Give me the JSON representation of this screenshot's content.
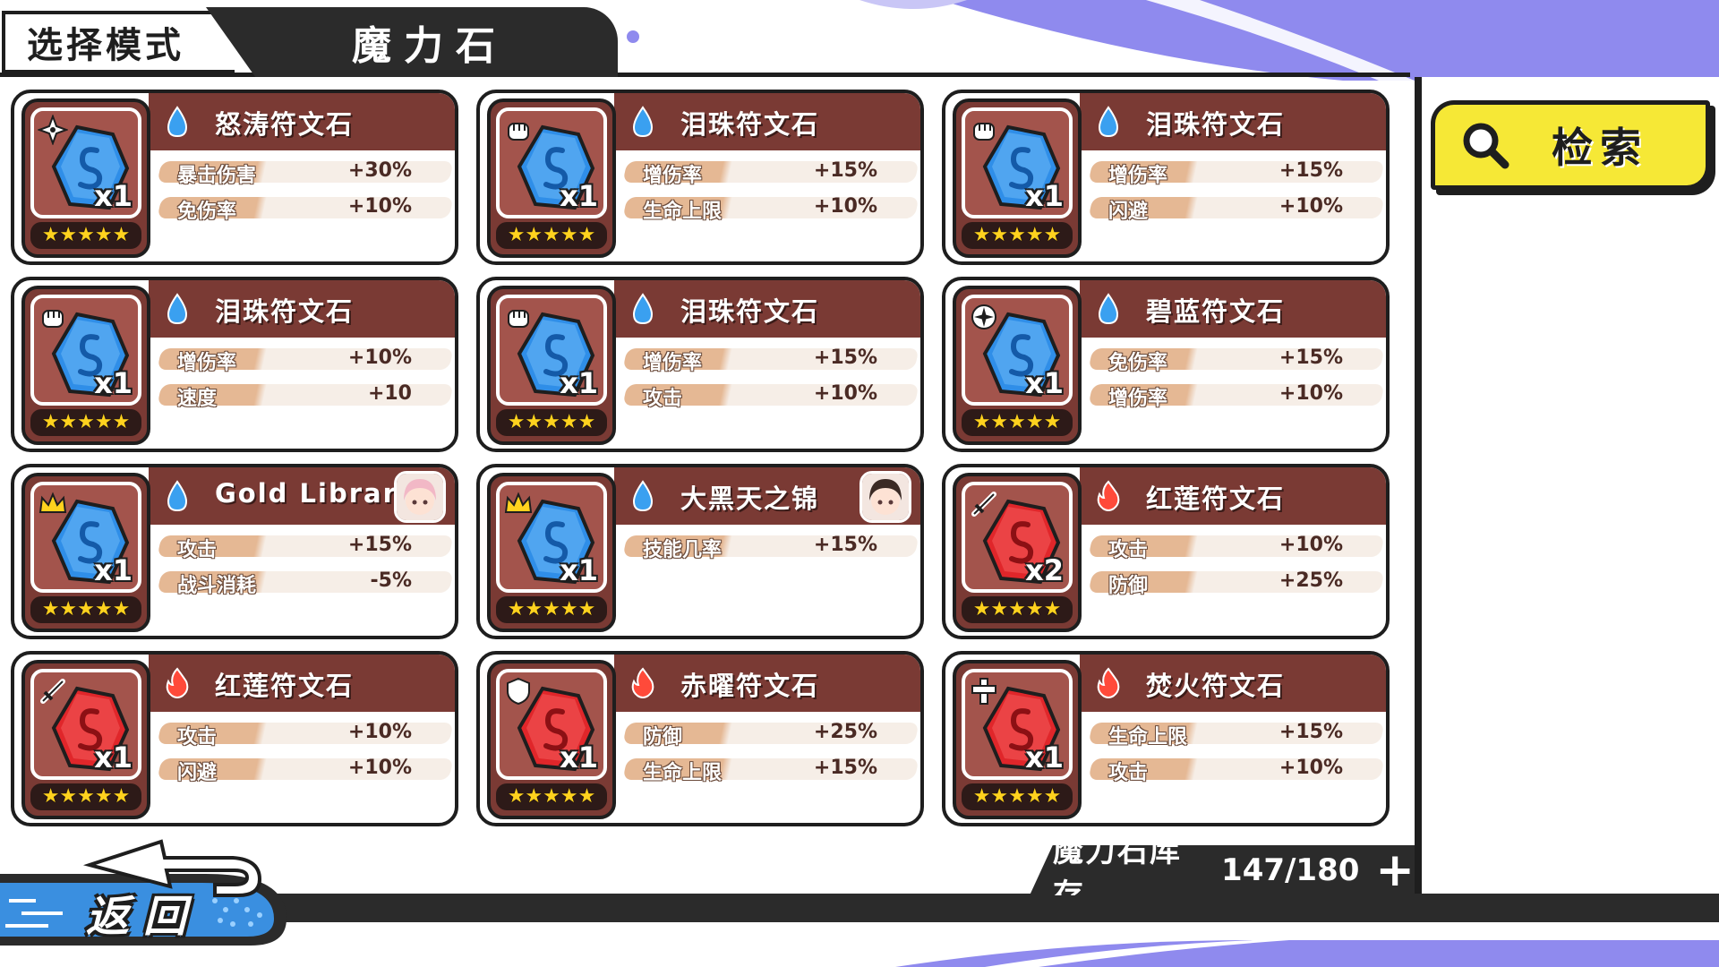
{
  "header": {
    "mode_label": "选择模式",
    "title": "魔力石"
  },
  "search": {
    "label": "检索",
    "icon": "magnifier-icon"
  },
  "colors": {
    "card_header": "#7a3a34",
    "accent_yellow": "#f6e836",
    "dark": "#2b2b2b",
    "water_gem": "#2f8ee8",
    "fire_gem": "#e0262a",
    "bg_purple": "#8f8aee"
  },
  "cards": [
    {
      "name": "怒涛符文石",
      "element": "water",
      "type_icon": "shuriken-icon",
      "qty": "x1",
      "stars": "★★★★★",
      "stats": [
        {
          "label": "暴击伤害",
          "value": "+30%"
        },
        {
          "label": "免伤率",
          "value": "+10%"
        }
      ]
    },
    {
      "name": "泪珠符文石",
      "element": "water",
      "type_icon": "fist-icon",
      "qty": "x1",
      "stars": "★★★★★",
      "stats": [
        {
          "label": "增伤率",
          "value": "+15%"
        },
        {
          "label": "生命上限",
          "value": "+10%"
        }
      ]
    },
    {
      "name": "泪珠符文石",
      "element": "water",
      "type_icon": "fist-icon",
      "qty": "x1",
      "stars": "★★★★★",
      "stats": [
        {
          "label": "增伤率",
          "value": "+15%"
        },
        {
          "label": "闪避",
          "value": "+10%"
        }
      ]
    },
    {
      "name": "泪珠符文石",
      "element": "water",
      "type_icon": "fist-icon",
      "qty": "x1",
      "stars": "★★★★★",
      "stats": [
        {
          "label": "增伤率",
          "value": "+10%"
        },
        {
          "label": "速度",
          "value": "+10"
        }
      ]
    },
    {
      "name": "泪珠符文石",
      "element": "water",
      "type_icon": "fist-icon",
      "qty": "x1",
      "stars": "★★★★★",
      "stats": [
        {
          "label": "增伤率",
          "value": "+15%"
        },
        {
          "label": "攻击",
          "value": "+10%"
        }
      ]
    },
    {
      "name": "碧蓝符文石",
      "element": "water",
      "type_icon": "compass-icon",
      "qty": "x1",
      "stars": "★★★★★",
      "stats": [
        {
          "label": "免伤率",
          "value": "+15%"
        },
        {
          "label": "增伤率",
          "value": "+10%"
        }
      ]
    },
    {
      "name": "Gold Library",
      "element": "water",
      "type_icon": "crown-icon",
      "qty": "x1",
      "stars": "★★★★★",
      "portrait": "pink-hair-character-portrait",
      "stats": [
        {
          "label": "攻击",
          "value": "+15%"
        },
        {
          "label": "战斗消耗",
          "value": "-5%"
        }
      ]
    },
    {
      "name": "大黑天之锦",
      "element": "water",
      "type_icon": "crown-icon",
      "qty": "x1",
      "stars": "★★★★★",
      "portrait": "dark-hair-character-portrait",
      "stats": [
        {
          "label": "技能几率",
          "value": "+15%"
        }
      ]
    },
    {
      "name": "红莲符文石",
      "element": "fire",
      "type_icon": "sword-icon",
      "qty": "x2",
      "stars": "★★★★★",
      "stats": [
        {
          "label": "攻击",
          "value": "+10%"
        },
        {
          "label": "防御",
          "value": "+25%"
        }
      ]
    },
    {
      "name": "红莲符文石",
      "element": "fire",
      "type_icon": "sword-icon",
      "qty": "x1",
      "stars": "★★★★★",
      "stats": [
        {
          "label": "攻击",
          "value": "+10%"
        },
        {
          "label": "闪避",
          "value": "+10%"
        }
      ]
    },
    {
      "name": "赤曜符文石",
      "element": "fire",
      "type_icon": "shield-icon",
      "qty": "x1",
      "stars": "★★★★★",
      "stats": [
        {
          "label": "防御",
          "value": "+25%"
        },
        {
          "label": "生命上限",
          "value": "+15%"
        }
      ]
    },
    {
      "name": "焚火符文石",
      "element": "fire",
      "type_icon": "cross-icon",
      "qty": "x1",
      "stars": "★★★★★",
      "stats": [
        {
          "label": "生命上限",
          "value": "+15%"
        },
        {
          "label": "攻击",
          "value": "+10%"
        }
      ]
    }
  ],
  "inventory": {
    "label": "魔力石库存",
    "count": "147/180",
    "add_symbol": "+"
  },
  "back": {
    "label": "返回"
  }
}
